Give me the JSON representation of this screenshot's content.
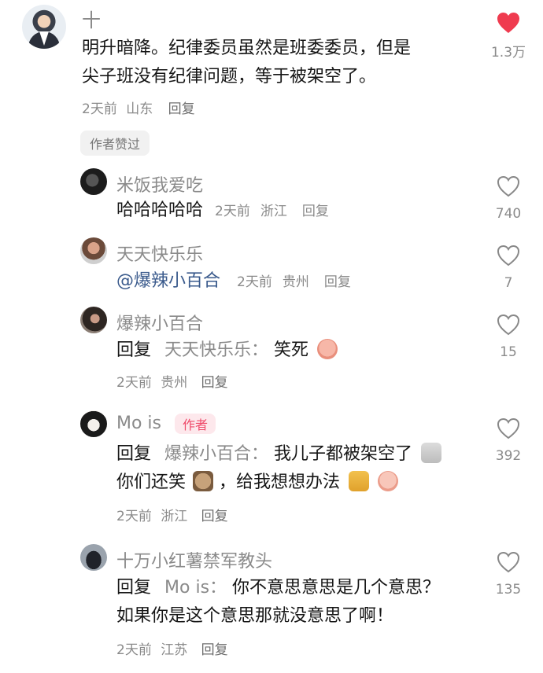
{
  "top_comment": {
    "avatar": "avatar-man-suit",
    "username": "十",
    "text_line1": "明升暗降。纪律委员虽然是班委委员，但是",
    "text_line2": "尖子班没有纪律问题，等于被架空了。",
    "meta_time": "2天前",
    "meta_location": "山东",
    "reply_label": "回复",
    "badge": "作者赞过",
    "likes": "1.3万",
    "liked": true,
    "like_color": "#ef3b4f"
  },
  "replies": [
    {
      "username": "米饭我爱吃",
      "text": "哈哈哈哈哈",
      "meta_time": "2天前",
      "meta_location": "浙江",
      "reply_label": "回复",
      "likes": "740"
    },
    {
      "username": "天天快乐乐",
      "mention": "@爆辣小百合",
      "meta_time": "2天前",
      "meta_location": "贵州",
      "reply_label": "回复",
      "likes": "7"
    },
    {
      "username": "爆辣小百合",
      "reply_prefix": "回复",
      "reply_to": "天天快乐乐：",
      "text": "笑死",
      "emoji": "pig-face-emoji",
      "meta_time": "2天前",
      "meta_location": "贵州",
      "reply_label": "回复",
      "likes": "15"
    },
    {
      "username": "Mo is",
      "author_tag": "作者",
      "reply_prefix": "回复",
      "reply_to": "爆辣小百合：",
      "text_line1": "我儿子都被架空了",
      "text_line2a": "你们还笑",
      "text_line2b": "，给我想想办法",
      "meta_time": "2天前",
      "meta_location": "浙江",
      "reply_label": "回复",
      "likes": "392"
    },
    {
      "username": "十万小红薯禁军教头",
      "reply_prefix": "回复",
      "reply_to": "Mo is：",
      "text_line1": "你不意思意思是几个意思？",
      "text_line2": "如果你是这个意思那就没意思了啊！",
      "meta_time": "2天前",
      "meta_location": "江苏",
      "reply_label": "回复",
      "likes": "135"
    }
  ]
}
